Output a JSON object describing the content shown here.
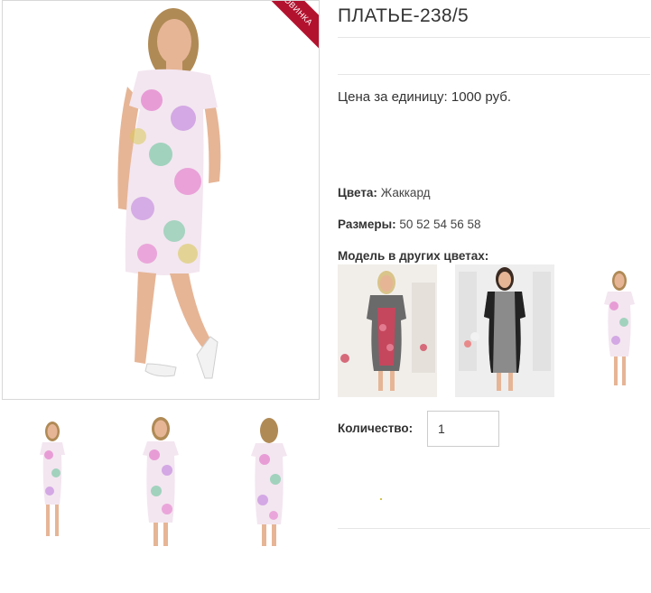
{
  "product": {
    "title": "ПЛАТЬЕ-238/5",
    "ribbon_label": "НОВИНКА",
    "price_label": "Цена за единицу: 1000 руб.",
    "color_key": "Цвета:",
    "color_value": "Жаккард",
    "sizes_key": "Размеры:",
    "sizes_value": "50 52 54 56 58",
    "other_colors_label": "Модель в других цветах:",
    "quantity_label": "Количество:",
    "quantity_value": "1"
  },
  "colors": {
    "ribbon": "#b3122e",
    "dress_base": "#f3e6f0",
    "dress_pink": "#e58ad0",
    "dress_green": "#7ec9a8",
    "skin": "#e6b596",
    "hair": "#b08a55"
  },
  "images": {
    "main": "dress-front-photo",
    "thumbs": [
      "dress-full-length-thumb",
      "dress-front-thumb",
      "dress-back-thumb"
    ],
    "variants": [
      "variant-red-pattern",
      "variant-grey-pattern",
      "variant-floral-small"
    ]
  }
}
